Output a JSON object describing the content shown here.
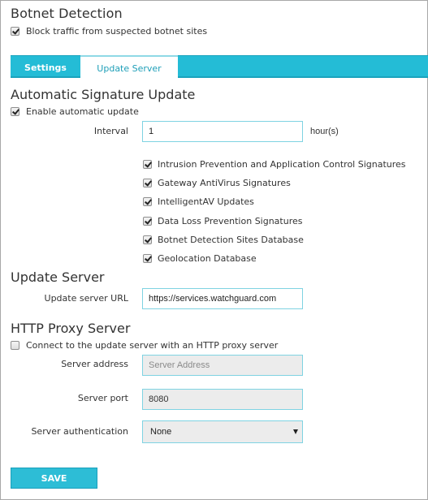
{
  "botnet": {
    "title": "Botnet Detection",
    "block_label": "Block traffic from suspected botnet sites",
    "block_checked": true
  },
  "tabs": [
    {
      "label": "Settings",
      "active": false
    },
    {
      "label": "Update Server",
      "active": true
    }
  ],
  "auto_update": {
    "title": "Automatic Signature Update",
    "enable_label": "Enable automatic update",
    "enable_checked": true,
    "interval_label": "Interval",
    "interval_value": "1",
    "interval_unit": "hour(s)",
    "signatures": [
      {
        "label": "Intrusion Prevention and Application Control Signatures",
        "checked": true
      },
      {
        "label": "Gateway AntiVirus Signatures",
        "checked": true
      },
      {
        "label": "IntelligentAV Updates",
        "checked": true
      },
      {
        "label": "Data Loss Prevention Signatures",
        "checked": true
      },
      {
        "label": "Botnet Detection Sites Database",
        "checked": true
      },
      {
        "label": "Geolocation Database",
        "checked": true
      }
    ]
  },
  "update_server": {
    "title": "Update Server",
    "url_label": "Update server URL",
    "url_value": "https://services.watchguard.com"
  },
  "proxy": {
    "title": "HTTP Proxy Server",
    "connect_label": "Connect to the update server with an HTTP proxy server",
    "connect_checked": false,
    "address_label": "Server address",
    "address_value": "",
    "address_placeholder": "Server Address",
    "port_label": "Server port",
    "port_value": "8080",
    "auth_label": "Server authentication",
    "auth_value": "None"
  },
  "actions": {
    "save_label": "SAVE"
  },
  "colors": {
    "accent": "#24bcd6",
    "accent_dark": "#1aa3bd",
    "active_tab_text": "#1f9fb8"
  }
}
